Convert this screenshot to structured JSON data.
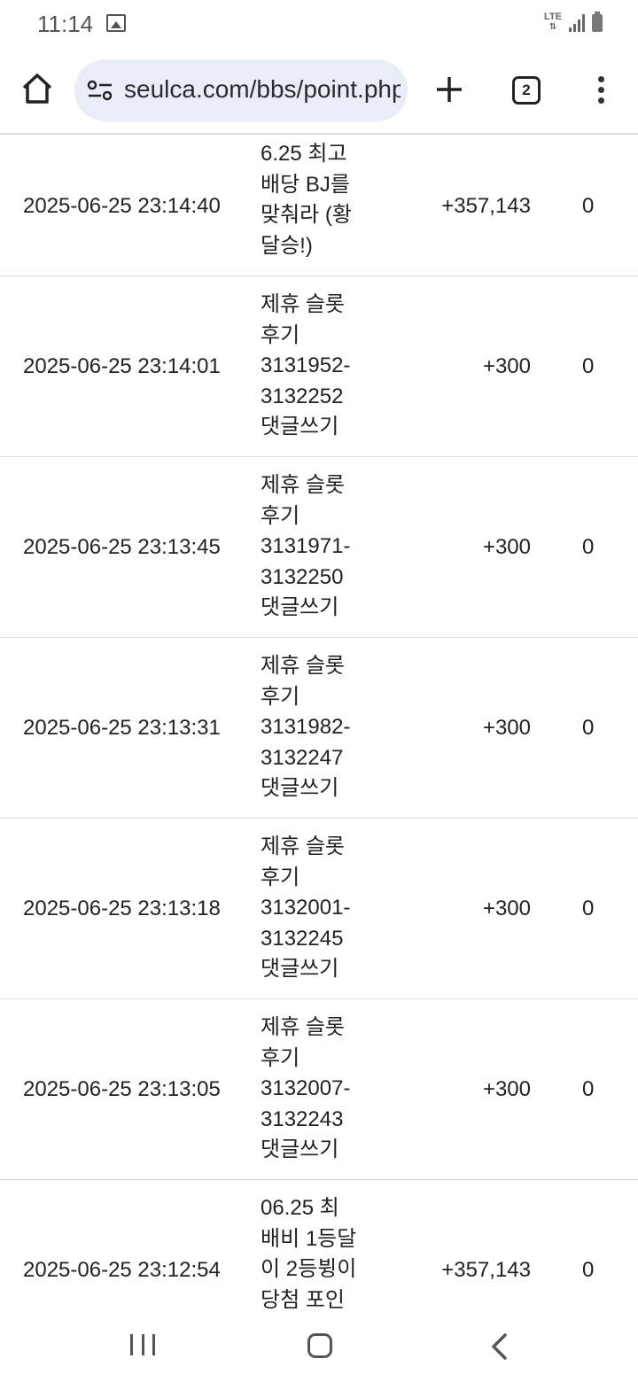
{
  "status": {
    "time": "11:14",
    "network": "LTE"
  },
  "browser": {
    "url": "seulca.com/bbs/point.php",
    "tab_count": "2",
    "icons": {
      "home": "home-icon",
      "site_info": "tune-icon",
      "new_tab": "plus-icon",
      "tabs": "tab-switcher-icon",
      "menu": "more-vert-icon"
    }
  },
  "rows": [
    {
      "date": "2025-06-25 23:14:40",
      "desc": [
        "6.25 최고",
        "배당 BJ를",
        "맞춰라 (황",
        "달승!)"
      ],
      "point": "+357,143",
      "used": "0"
    },
    {
      "date": "2025-06-25 23:14:01",
      "desc": [
        "제휴 슬롯",
        "후기",
        "3131952-",
        "3132252",
        "댓글쓰기"
      ],
      "point": "+300",
      "used": "0"
    },
    {
      "date": "2025-06-25 23:13:45",
      "desc": [
        "제휴 슬롯",
        "후기",
        "3131971-",
        "3132250",
        "댓글쓰기"
      ],
      "point": "+300",
      "used": "0"
    },
    {
      "date": "2025-06-25 23:13:31",
      "desc": [
        "제휴 슬롯",
        "후기",
        "3131982-",
        "3132247",
        "댓글쓰기"
      ],
      "point": "+300",
      "used": "0"
    },
    {
      "date": "2025-06-25 23:13:18",
      "desc": [
        "제휴 슬롯",
        "후기",
        "3132001-",
        "3132245",
        "댓글쓰기"
      ],
      "point": "+300",
      "used": "0"
    },
    {
      "date": "2025-06-25 23:13:05",
      "desc": [
        "제휴 슬롯",
        "후기",
        "3132007-",
        "3132243",
        "댓글쓰기"
      ],
      "point": "+300",
      "used": "0"
    },
    {
      "date": "2025-06-25 23:12:54",
      "desc": [
        "06.25 최",
        "배비 1등달",
        "이 2등뷩이",
        "당첨 포인"
      ],
      "point": "+357,143",
      "used": "0"
    }
  ],
  "nav": {
    "recent": "recent-apps-icon",
    "home": "home-circle-icon",
    "back": "back-icon"
  }
}
